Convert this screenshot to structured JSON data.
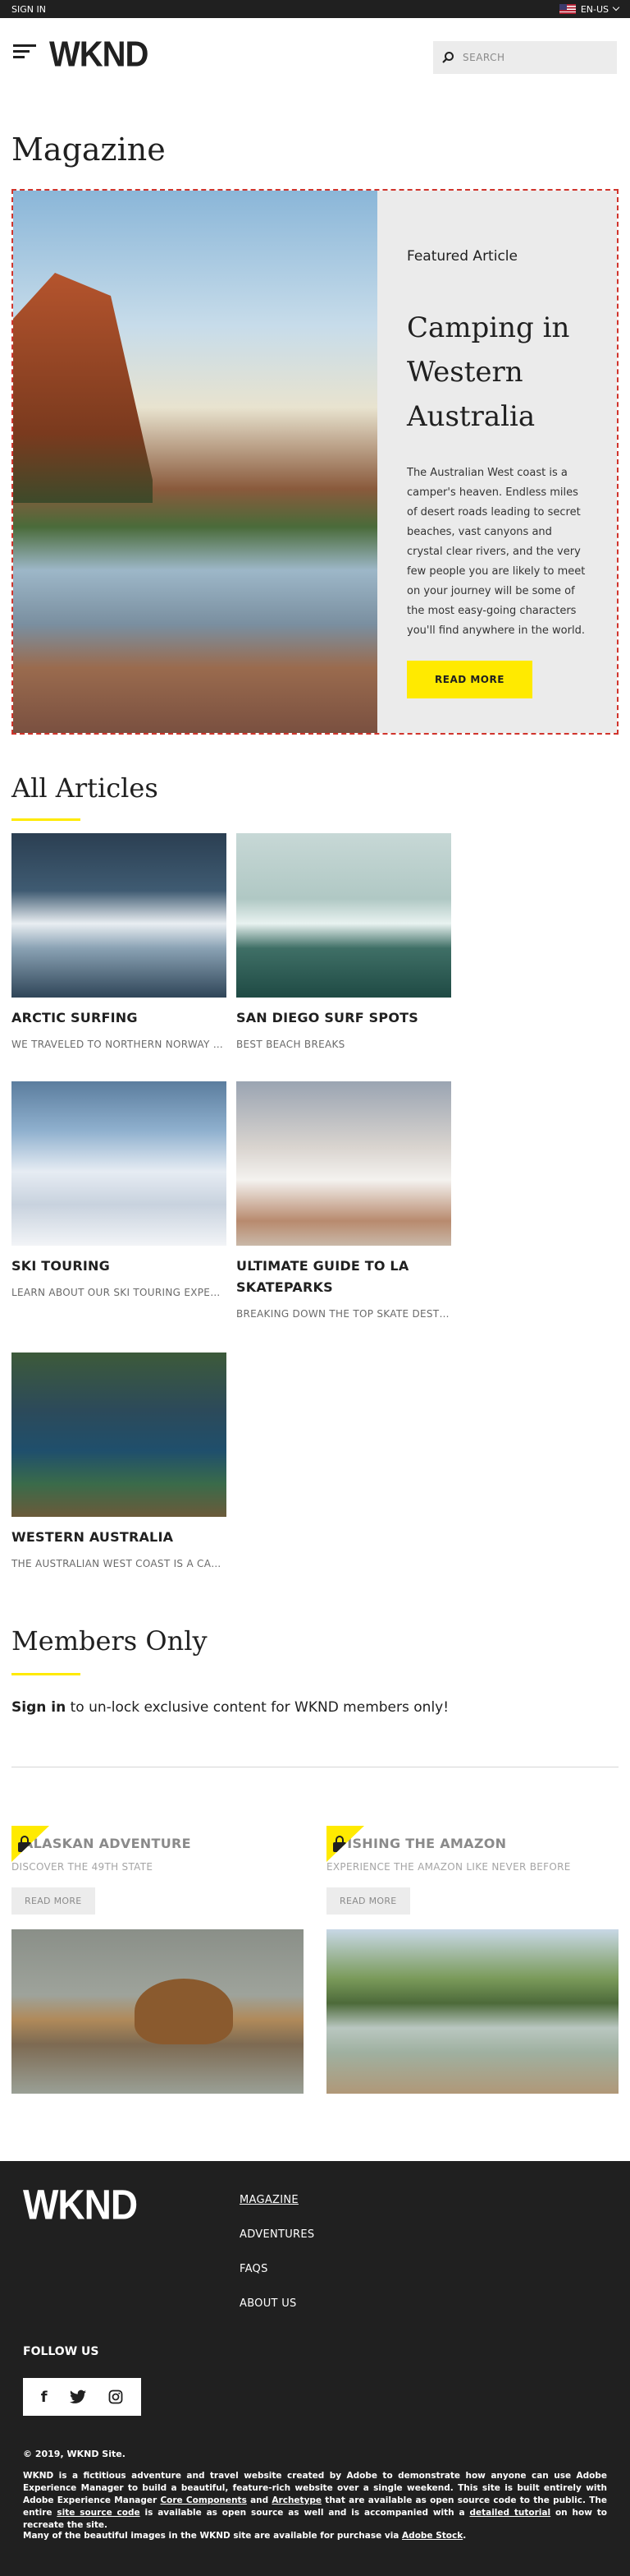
{
  "utility": {
    "sign_in": "SIGN IN",
    "language": "EN-US"
  },
  "header": {
    "logo": "WKND",
    "search_placeholder": "SEARCH"
  },
  "page_title": "Magazine",
  "featured": {
    "label": "Featured Article",
    "title": "Camping in Western Australia",
    "description": "The Australian West coast is a camper's heaven. Endless miles of desert roads leading to secret beaches, vast canyons and crystal clear rivers, and the very few people you are likely to meet on your journey will be some of the most easy-going characters you'll find anywhere in the world.",
    "button": "READ MORE"
  },
  "all_articles": {
    "title": "All Articles",
    "items": [
      {
        "title": "ARCTIC SURFING",
        "description": "WE TRAVELED TO NORTHERN NORWAY TO SURF"
      },
      {
        "title": "SAN DIEGO SURF SPOTS",
        "description": "BEST BEACH BREAKS"
      },
      {
        "title": "SKI TOURING",
        "description": "LEARN ABOUT OUR SKI TOURING EXPERIENCE"
      },
      {
        "title": "ULTIMATE GUIDE TO LA SKATEPARKS",
        "description": "BREAKING DOWN THE TOP SKATE DESTINATIONS"
      },
      {
        "title": "WESTERN AUSTRALIA",
        "description": "THE AUSTRALIAN WEST COAST IS A CAMPER'S HEAVEN"
      }
    ]
  },
  "members": {
    "title": "Members Only",
    "sign_in": "Sign in",
    "text": " to un-lock exclusive content for WKND members only!",
    "locked": [
      {
        "title": "ALASKAN ADVENTURE",
        "subtitle": "DISCOVER THE 49TH STATE",
        "button": "READ MORE"
      },
      {
        "title": "FISHING THE AMAZON",
        "subtitle": "EXPERIENCE THE AMAZON LIKE NEVER BEFORE",
        "button": "READ MORE"
      }
    ]
  },
  "footer": {
    "logo": "WKND",
    "nav": [
      "MAGAZINE",
      "ADVENTURES",
      "FAQS",
      "ABOUT US"
    ],
    "follow": "FOLLOW US",
    "social": {
      "facebook": "f",
      "twitter": "🐦",
      "instagram": "◎"
    },
    "copyright": "© 2019, WKND Site.",
    "description_parts": {
      "a": "WKND is a fictitious adventure and travel website created by Adobe to demonstrate how anyone can use Adobe Experience Manager to build a beautiful, feature-rich website over a single weekend. This site is built entirely with Adobe Experience Manager ",
      "core": "Core Components",
      "b": " and ",
      "archetype": "Archetype",
      "c": " that are available as open source code to the public. The entire ",
      "source": "site source code",
      "d": " is available as open source as well and is accompanied with a ",
      "tutorial": "detailed tutorial",
      "e": " on how to recreate the site."
    },
    "credit": "Many of the beautiful images in the WKND site are available for purchase via ",
    "credit_link": "Adobe Stock",
    "credit_end": "."
  }
}
